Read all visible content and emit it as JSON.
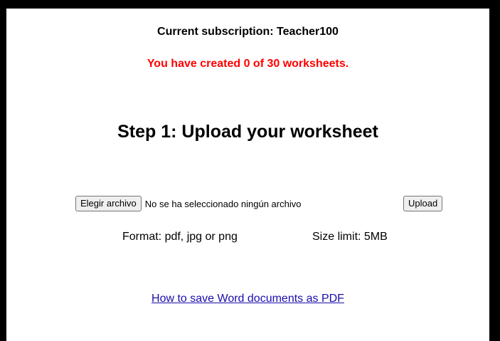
{
  "header": {
    "subscription_text": "Current subscription: Teacher100",
    "created_text": "You have created 0 of 30 worksheets."
  },
  "main": {
    "step_title": "Step 1: Upload your worksheet",
    "file_input": {
      "choose_label": "Elegir archivo",
      "no_file_text": "No se ha seleccionado ningún archivo"
    },
    "upload_label": "Upload",
    "format_text": "Format: pdf, jpg or png",
    "size_text": "Size limit: 5MB",
    "help_link_text": "How to save Word documents as PDF"
  },
  "colors": {
    "warning": "#ff0000",
    "link": "#1a0dab",
    "frame": "#000000"
  }
}
